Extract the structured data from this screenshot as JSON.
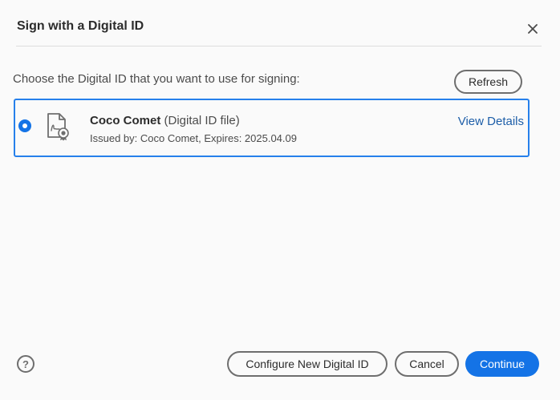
{
  "dialog": {
    "title": "Sign with a Digital ID",
    "close_icon": "close-icon"
  },
  "instruction": "Choose the Digital ID that you want to use for signing:",
  "refresh_label": "Refresh",
  "digital_ids": [
    {
      "name": "Coco Comet",
      "type": "(Digital ID file)",
      "issued": "Issued by: Coco Comet, Expires: 2025.04.09",
      "view_details_label": "View Details",
      "selected": true,
      "icon": "certificate-icon"
    }
  ],
  "footer": {
    "help_icon": "help-icon",
    "help_glyph": "?",
    "configure_label": "Configure New Digital ID",
    "cancel_label": "Cancel",
    "continue_label": "Continue"
  },
  "colors": {
    "accent": "#1473e6",
    "selection_border": "#2680eb",
    "link": "#1d5ea8"
  }
}
